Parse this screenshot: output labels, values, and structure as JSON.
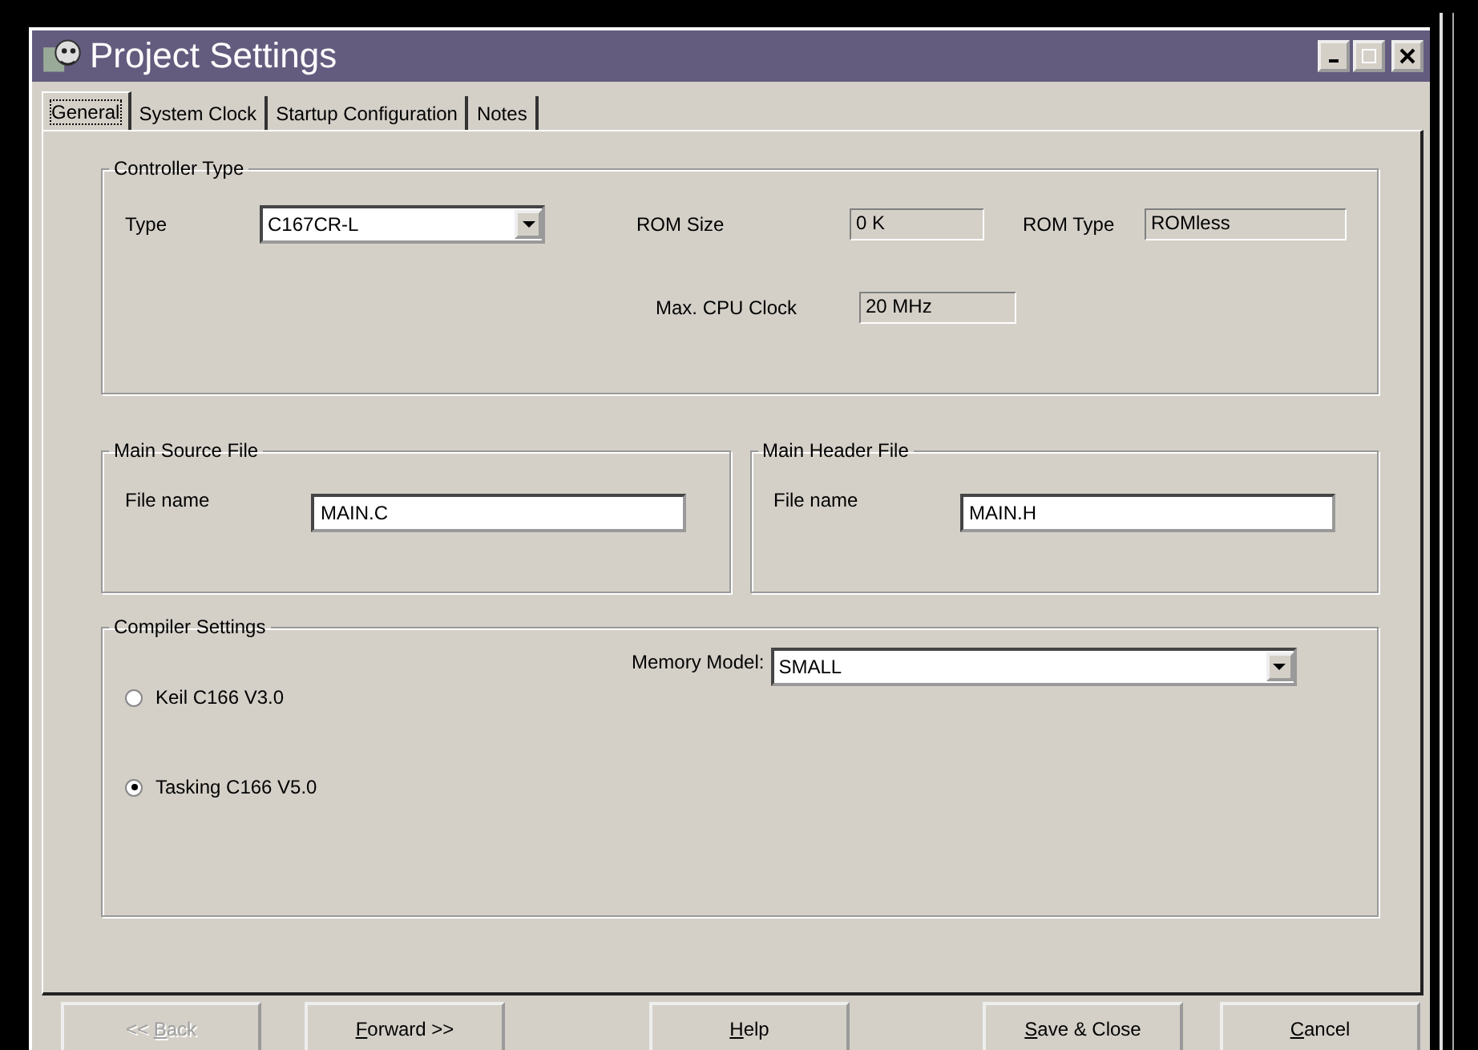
{
  "window": {
    "title": "Project Settings"
  },
  "tabs": [
    {
      "label": "General",
      "selected": true
    },
    {
      "label": "System Clock",
      "selected": false
    },
    {
      "label": "Startup Configuration",
      "selected": false
    },
    {
      "label": "Notes",
      "selected": false
    }
  ],
  "controller_type": {
    "title": "Controller Type",
    "type_label": "Type",
    "type_value": "C167CR-L",
    "rom_size_label": "ROM Size",
    "rom_size": "0 K",
    "rom_type_label": "ROM Type",
    "rom_type": "ROMless",
    "max_clock_label": "Max. CPU Clock",
    "max_clock": "20 MHz"
  },
  "main_source_file": {
    "title": "Main Source File",
    "label": "File name",
    "value": "MAIN.C"
  },
  "main_header_file": {
    "title": "Main Header File",
    "label": "File name",
    "value": "MAIN.H"
  },
  "compiler_settings": {
    "title": "Compiler Settings",
    "compilers": [
      {
        "label": "Keil C166 V3.0",
        "selected": false
      },
      {
        "label": "Tasking C166 V5.0",
        "selected": true
      }
    ],
    "memory_model_label": "Memory Model:",
    "memory_model": "SMALL"
  },
  "buttons": [
    {
      "label_start": "<< ",
      "access_key": "B",
      "label_end": "ack",
      "disabled": true
    },
    {
      "access_key": "F",
      "label_end": "orward >>",
      "disabled": false
    },
    {
      "access_key": "H",
      "label_end": "elp",
      "disabled": false
    },
    {
      "access_key": "S",
      "label_end": "ave & Close",
      "disabled": false
    },
    {
      "access_key": "C",
      "label_end": "ancel",
      "disabled": false
    }
  ]
}
